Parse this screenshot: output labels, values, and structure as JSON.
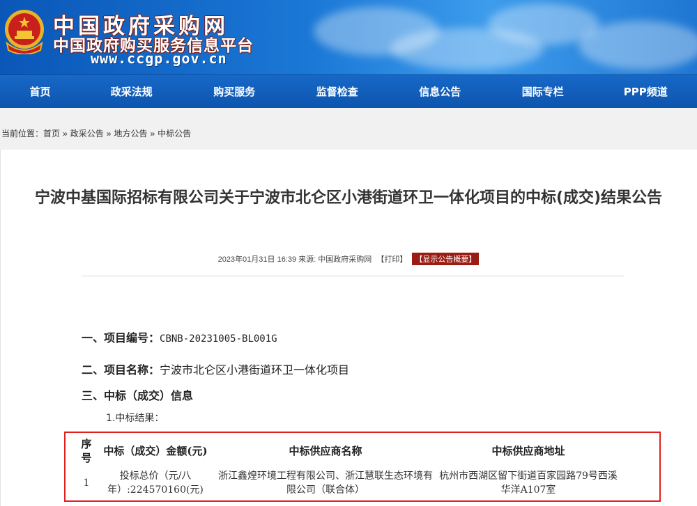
{
  "header": {
    "title": "中国政府采购网",
    "subtitle": "中国政府购买服务信息平台",
    "url": "www.ccgp.gov.cn"
  },
  "nav": {
    "items": [
      "首页",
      "政采法规",
      "购买服务",
      "监督检查",
      "信息公告",
      "国际专栏",
      "PPP频道"
    ]
  },
  "breadcrumb": {
    "prefix": "当前位置：",
    "items": [
      "首页",
      "政采公告",
      "地方公告",
      "中标公告"
    ],
    "separator": "»"
  },
  "article": {
    "title": "宁波中基国际招标有限公司关于宁波市北仑区小港街道环卫一体化项目的中标(成交)结果公告",
    "meta": "2023年01月31日 16:39 来源: 中国政府采购网",
    "print_label": "【打印】",
    "summary_label": "【显示公告概要】",
    "item1_label": "一、项目编号：",
    "item1_value": "CBNB-20231005-BL001G",
    "item2_label": "二、项目名称：",
    "item2_value": "宁波市北仑区小港街道环卫一体化项目",
    "item3_label": "三、中标（成交）信息",
    "sub_label": "1.中标结果："
  },
  "result_table": {
    "headers": [
      "序号",
      "中标（成交）金额(元)",
      "中标供应商名称",
      "中标供应商地址"
    ],
    "rows": [
      {
        "no": "1",
        "amount": "投标总价（元/八年）:224570160(元)",
        "name": "浙江鑫煌环境工程有限公司、浙江慧联生态环境有限公司（联合体）",
        "address": "杭州市西湖区留下街道百家园路79号西溪华洋A107室"
      }
    ]
  },
  "colors": {
    "nav_blue": "#0d55ae",
    "summary_red": "#9b1c12",
    "highlight_border": "#e02020"
  }
}
